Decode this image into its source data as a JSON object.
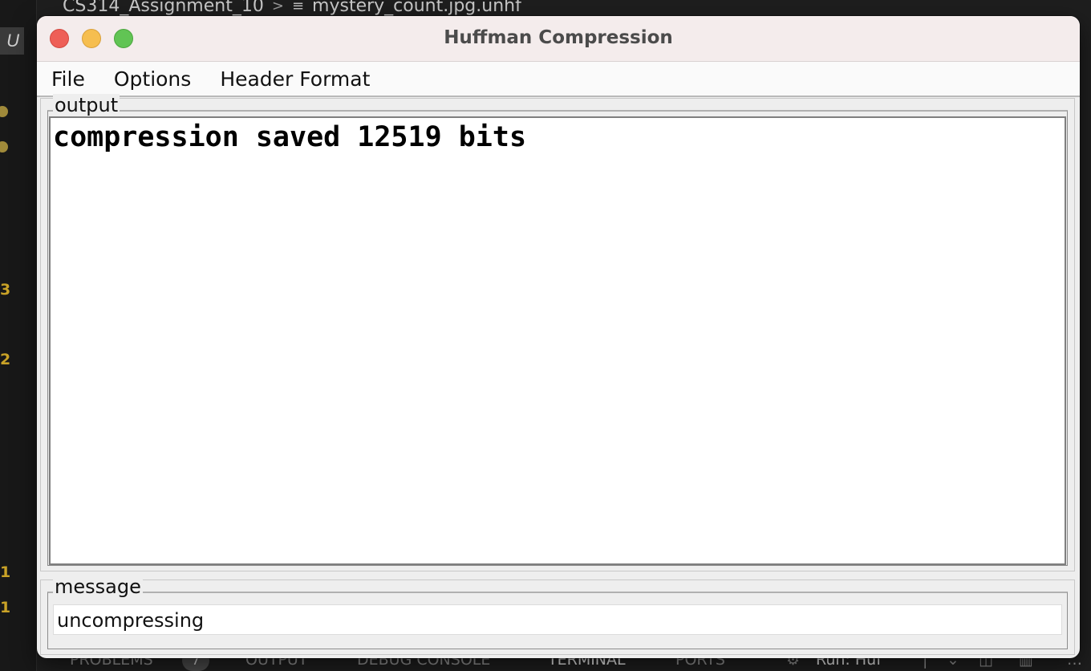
{
  "ide": {
    "breadcrumb": {
      "project": "CS314_Assignment_10",
      "separator": ">",
      "file": "mystery_count.jpg.unhf"
    },
    "activity_icon_letter": "U",
    "gutter_numbers": [
      "3",
      "2",
      "1",
      "1"
    ],
    "panel_tabs": {
      "problems": "PROBLEMS",
      "problems_count": "7",
      "output": "OUTPUT",
      "debug_console": "DEBUG CONSOLE",
      "terminal": "TERMINAL",
      "ports": "PORTS",
      "run_label": "Run: Huf"
    }
  },
  "window": {
    "title": "Huffman Compression",
    "menu": [
      "File",
      "Options",
      "Header Format"
    ],
    "output": {
      "label": "output",
      "text": "compression saved 12519 bits"
    },
    "message": {
      "label": "message",
      "text": "uncompressing"
    }
  }
}
